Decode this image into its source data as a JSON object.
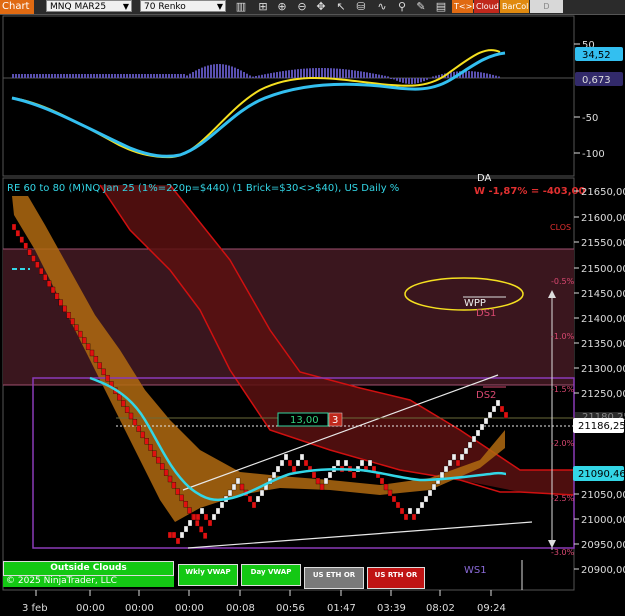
{
  "toolbar": {
    "tab_label": "Chart",
    "instrument": "MNQ MAR25",
    "bar_type": "70 Renko",
    "buttons": [
      "T<>K",
      "Cloud",
      "BarCol",
      "D VWAP"
    ],
    "button_colors": [
      "#e06a12",
      "#c0281c",
      "#e08a10",
      "#cccccc"
    ]
  },
  "oscillator": {
    "y_ticks": [
      "50",
      "-50",
      "-100"
    ],
    "value_yellow": "34,52",
    "value_blue": "0,673"
  },
  "price_panel": {
    "title": "RE 60 to 80 (M)NQ Jan 25 (1%=220p=$440) (1 Brick=$30<>$40), US Daily %",
    "top_right_partial": "DA",
    "pnl_text": "W -1,87% = -403,00",
    "clos_label": "CLOS",
    "wpp_label": "WPP",
    "ds1_label": "DS1",
    "ds2_label": "DS2",
    "ws1_label": "WS1",
    "box_left": "13,00",
    "box_right": "3",
    "percent_labels": [
      "-0.5%",
      "-1.0%",
      "-1.5%",
      "-2.0%",
      "-2.5%",
      "-3.0%"
    ],
    "y_ticks": [
      "21650,00",
      "21600,00",
      "21550,00",
      "21500,00",
      "21450,00",
      "21400,00",
      "21350,00",
      "21300,00",
      "21250,00",
      "21050,00",
      "21000,00",
      "20950,00",
      "20900,00"
    ],
    "hidden_tick": "21180,25",
    "price_marker_white": "21186,25",
    "price_marker_cyan": "21090,46"
  },
  "x_axis": [
    "3 feb",
    "00:00",
    "00:00",
    "00:00",
    "00:08",
    "00:56",
    "01:47",
    "03:39",
    "08:02",
    "09:24"
  ],
  "bottom_buttons": {
    "outside_clouds": "Outside Clouds",
    "copyright": "© 2025 NinjaTrader, LLC",
    "wkly_vwap": "Wkly VWAP",
    "day_vwap": "Day VWAP",
    "us_eth_or": "US ETH OR",
    "us_rth_or": "US RTH OR"
  },
  "colors": {
    "cloud_orange": "#b06a10",
    "cloud_red": "#5a1010",
    "resistance_band": "#3a161e",
    "range_box": "#8a3ab8",
    "cyan": "#33d6e6",
    "yellow": "#f5e020",
    "histogram": "#5a50b0"
  },
  "chart_data": {
    "type": "renko-bricks",
    "y_unit": "price",
    "price_levels": {
      "wpp": 21445,
      "ds1": 21420,
      "ds2": 21230,
      "ws1": 20900,
      "current": 21186.25,
      "cyan_ma_last": 21090.46
    }
  }
}
